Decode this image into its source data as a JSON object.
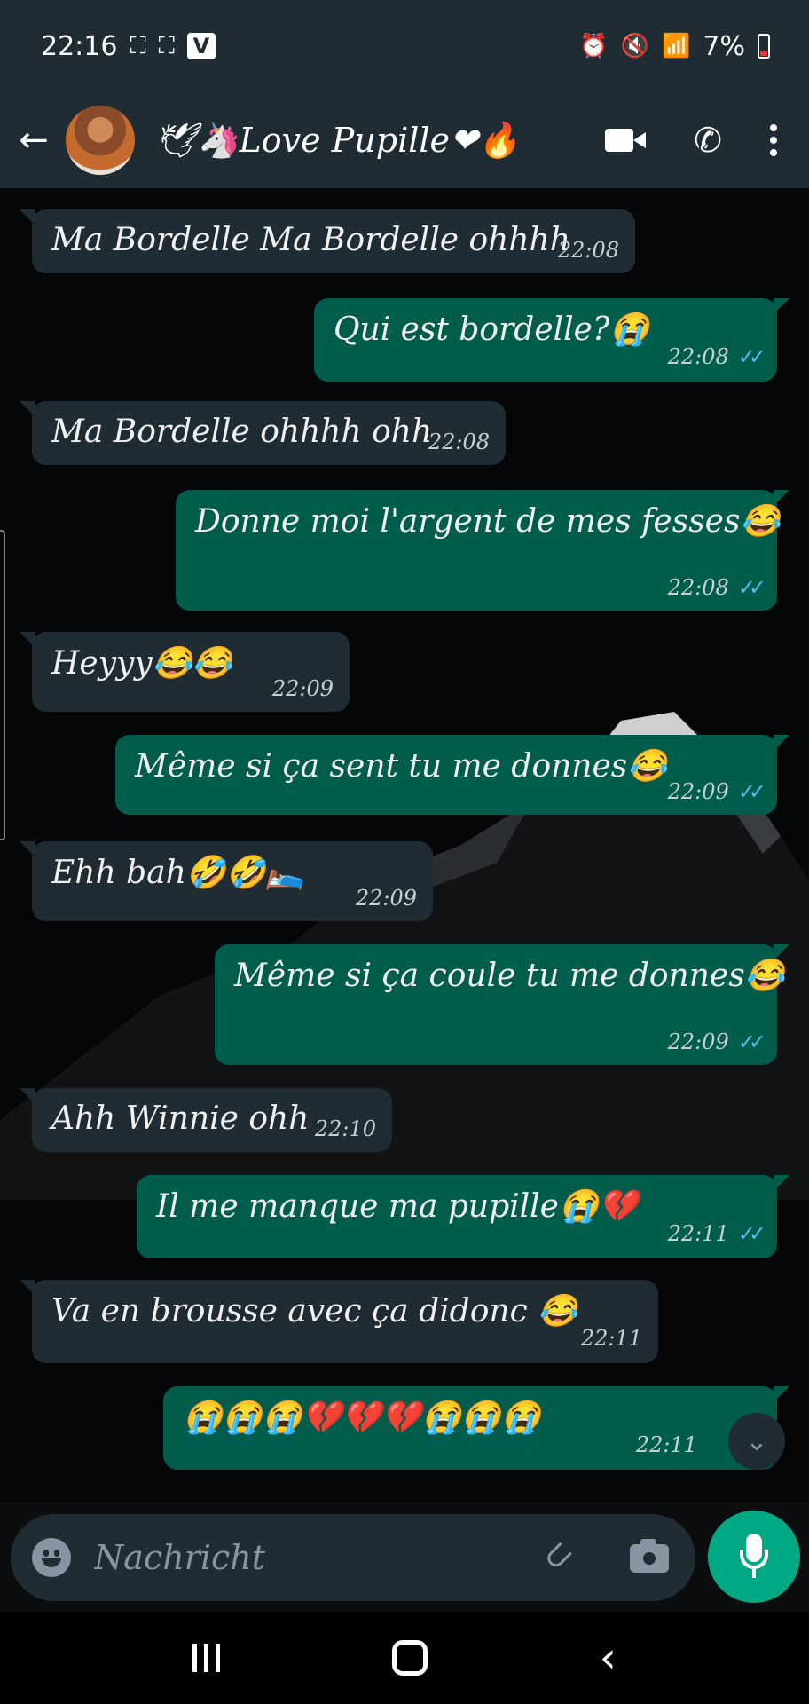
{
  "status_bar": {
    "time": "22:16",
    "battery": "7%"
  },
  "header": {
    "contact_name": "🕊🦄Love Pupille❤🔥",
    "back_icon": "arrow-left-icon",
    "video_icon": "video-call-icon",
    "call_icon": "phone-icon",
    "menu_icon": "more-vert-icon"
  },
  "messages": [
    {
      "direction": "in",
      "text": "Ma Bordelle Ma Bordelle ohhhh",
      "time": "22:08"
    },
    {
      "direction": "out",
      "text": "Qui est bordelle?😭",
      "time": "22:08",
      "ticks": "✓✓"
    },
    {
      "direction": "in",
      "text": "Ma Bordelle ohhhh ohh",
      "time": "22:08"
    },
    {
      "direction": "out",
      "text": "Donne moi l'argent de mes fesses😂",
      "time": "22:08",
      "ticks": "✓✓"
    },
    {
      "direction": "in",
      "text": "Heyyy😂😂",
      "time": "22:09"
    },
    {
      "direction": "out",
      "text": "Même si ça sent tu me donnes😂",
      "time": "22:09",
      "ticks": "✓✓"
    },
    {
      "direction": "in",
      "text": "Ehh bah🤣🤣🛌",
      "time": "22:09"
    },
    {
      "direction": "out",
      "text": "Même si ça coule tu me donnes😂",
      "time": "22:09",
      "ticks": "✓✓"
    },
    {
      "direction": "in",
      "text": "Ahh Winnie ohh",
      "time": "22:10"
    },
    {
      "direction": "out",
      "text": "Il me manque ma pupille😭💔",
      "time": "22:11",
      "ticks": "✓✓"
    },
    {
      "direction": "in",
      "text": "Va en brousse avec ça didonc 😂",
      "time": "22:11"
    },
    {
      "direction": "out",
      "text": "😭😭😭💔💔💔😭😭😭",
      "time": "22:11"
    }
  ],
  "composer": {
    "placeholder": "Nachricht",
    "emoji_icon": "emoji-icon",
    "attach_icon": "paperclip-icon",
    "camera_icon": "camera-icon",
    "mic_icon": "microphone-icon"
  },
  "colors": {
    "header_bg": "#1f2c33",
    "incoming_bubble": "#1f2c33",
    "outgoing_bubble": "#005c4b",
    "read_ticks": "#53bdeb",
    "accent": "#00a884"
  }
}
